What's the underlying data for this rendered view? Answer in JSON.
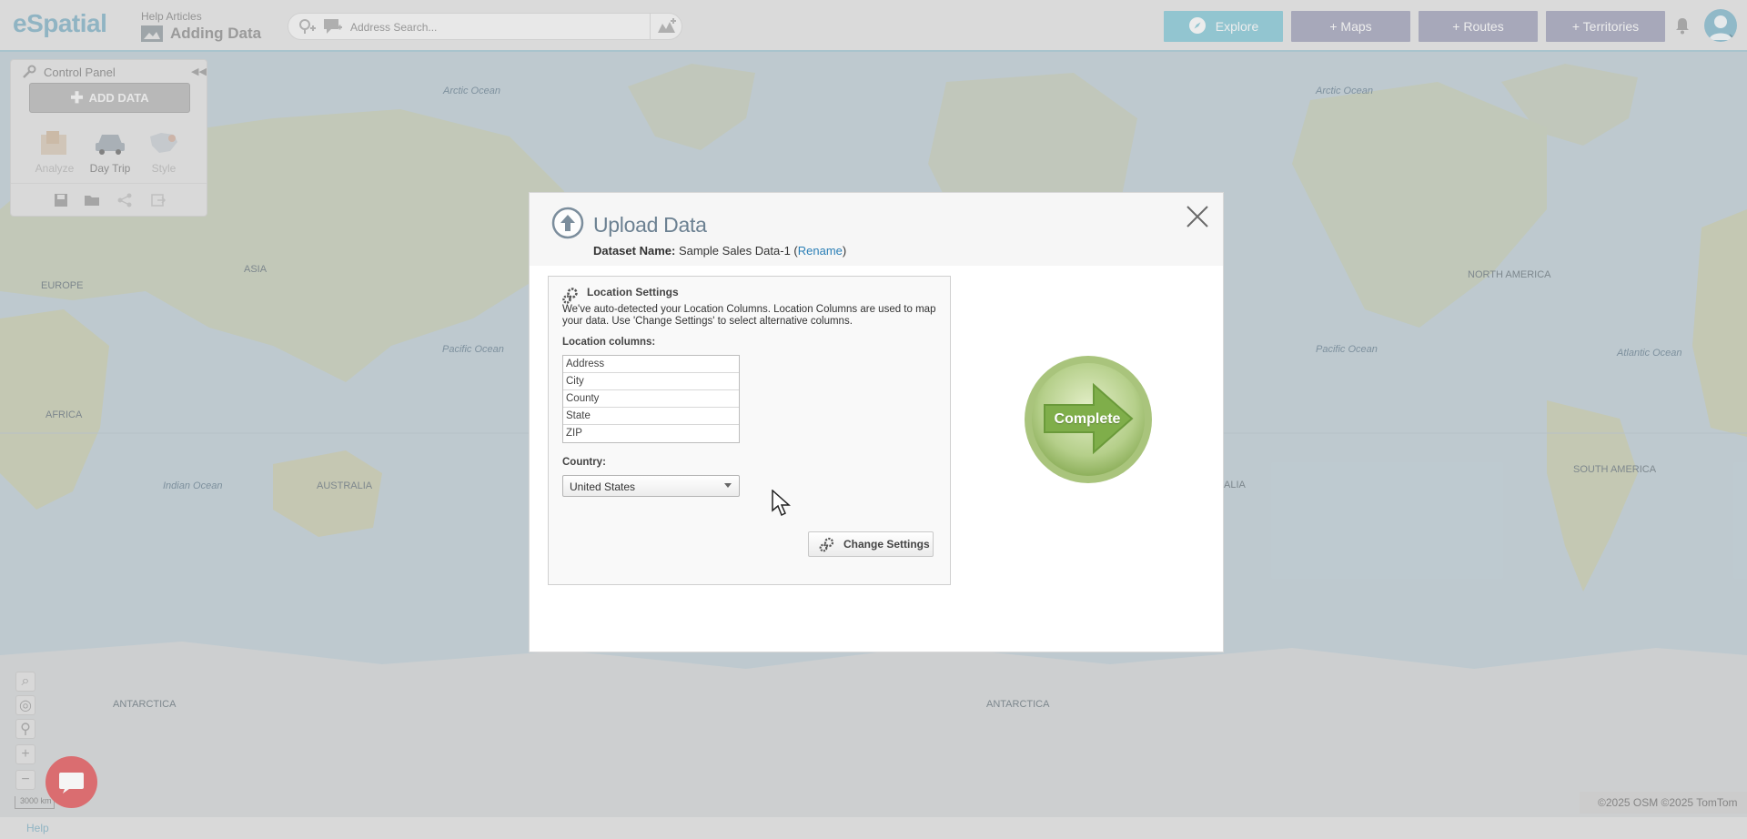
{
  "app": {
    "logo": "eSpatial"
  },
  "header": {
    "help_articles": "Help Articles",
    "page_title": "Adding Data",
    "search_placeholder": "Address Search...",
    "buttons": {
      "explore": "Explore",
      "maps": "+ Maps",
      "routes": "+ Routes",
      "territories": "+ Territories"
    }
  },
  "control_panel": {
    "title": "Control Panel",
    "add_data": "ADD DATA",
    "tools": [
      {
        "label": "Analyze",
        "icon": "analyze-icon"
      },
      {
        "label": "Day Trip",
        "icon": "car-icon"
      },
      {
        "label": "Style",
        "icon": "style-icon"
      }
    ],
    "mini_icons": [
      "save-icon",
      "open-folder-icon",
      "share-icon",
      "export-icon"
    ]
  },
  "map": {
    "labels": {
      "arctic_1": "Arctic Ocean",
      "arctic_2": "Arctic Ocean",
      "asia": "ASIA",
      "europe": "EUROPE",
      "africa": "AFRICA",
      "pacific_1": "Pacific Ocean",
      "pacific_2": "Pacific Ocean",
      "indian": "Indian Ocean",
      "australia": "AUSTRALIA",
      "north_america": "NORTH AMERICA",
      "atlantic": "Atlantic Ocean",
      "south_america": "SOUTH AMERICA",
      "alia_fragment": "ALIA",
      "antarctica_1": "ANTARCTICA",
      "antarctica_2": "ANTARCTICA"
    },
    "scale": "3000 km",
    "copyright": "©2025 OSM ©2025 TomTom"
  },
  "footer": {
    "help": "Help"
  },
  "dialog": {
    "title": "Upload Data",
    "dataset_label": "Dataset Name:",
    "dataset_name": "Sample Sales Data-1",
    "rename": "Rename",
    "location_settings": {
      "title": "Location Settings",
      "description": "We've auto-detected your Location Columns. Location Columns are used to map your data. Use 'Change Settings' to select alternative columns.",
      "columns_label": "Location columns:",
      "columns": [
        "Address",
        "City",
        "County",
        "State",
        "ZIP"
      ],
      "country_label": "Country:",
      "country_value": "United States",
      "change_settings": "Change Settings"
    },
    "complete": "Complete"
  },
  "colors": {
    "accent": "#6db8c9",
    "nav_button": "#8c8ea9",
    "complete_green": "#7fae4a",
    "link": "#2b7fb6",
    "chat": "#d7373b"
  }
}
